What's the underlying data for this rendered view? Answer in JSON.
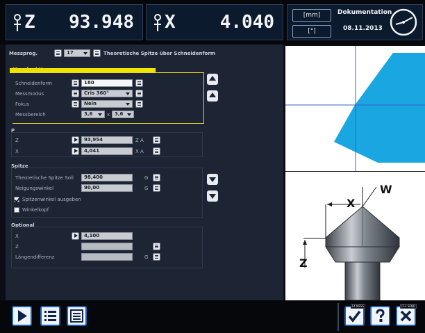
{
  "axes": [
    {
      "name": "Z",
      "value": "93.948"
    },
    {
      "name": "X",
      "value": "4.040"
    }
  ],
  "units": {
    "unit_mm": "[mm]",
    "unit_deg": "[°]"
  },
  "documentation": {
    "label": "Dokumentation",
    "date": "08.11.2013"
  },
  "header": {
    "label": "Messprog.",
    "program_no": "17",
    "program_title": "Theoretische Spitze über Schneidenform"
  },
  "section1": {
    "title": "Messfunktion",
    "rows": [
      {
        "label": "Schneidenform",
        "value": "180"
      },
      {
        "label": "Messmodus",
        "value": "Cris 360°"
      },
      {
        "label": "Fokus",
        "value": "Nein"
      },
      {
        "label": "Messbereich",
        "value": "3,6",
        "value2": "3,6",
        "sep": "x"
      }
    ]
  },
  "section2": {
    "title": "P",
    "rows": [
      {
        "label": "Z",
        "value": "93,954",
        "unit": "Z A"
      },
      {
        "label": "X",
        "value": "4,041",
        "unit": "X A"
      }
    ]
  },
  "section3": {
    "title": "Spitze",
    "rows": [
      {
        "label": "Theoretische Spitze Soll",
        "value": "98,400",
        "unit": "G"
      },
      {
        "label": "Neigungswinkel",
        "value": "90,00",
        "unit": "G"
      }
    ],
    "checkboxes": [
      {
        "label": "Spitzenwinkel ausgeben",
        "checked": true
      },
      {
        "label": "Winkelkopf",
        "checked": false
      }
    ]
  },
  "section4": {
    "title": "Optional",
    "rows": [
      {
        "label": "X",
        "value": "4,100"
      },
      {
        "label": "Z",
        "value": ""
      },
      {
        "label": "Längendifferenz",
        "value": "",
        "unit": "G"
      }
    ]
  },
  "diagram": {
    "label_w": "W",
    "label_x": "X",
    "label_z": "Z"
  },
  "bottom": {
    "badge_ok": "F4\nMESS",
    "badge_help": "",
    "badge_close": "F12\nSEND"
  },
  "colors": {
    "accent_blue": "#1b64b4",
    "cyan": "#1aa6e0",
    "highlight": "#f2e600"
  },
  "icons": [
    "z-axis-icon",
    "x-axis-icon",
    "clock-icon",
    "play-icon",
    "list-icon",
    "menu-icon",
    "confirm-icon",
    "help-icon",
    "close-icon"
  ]
}
